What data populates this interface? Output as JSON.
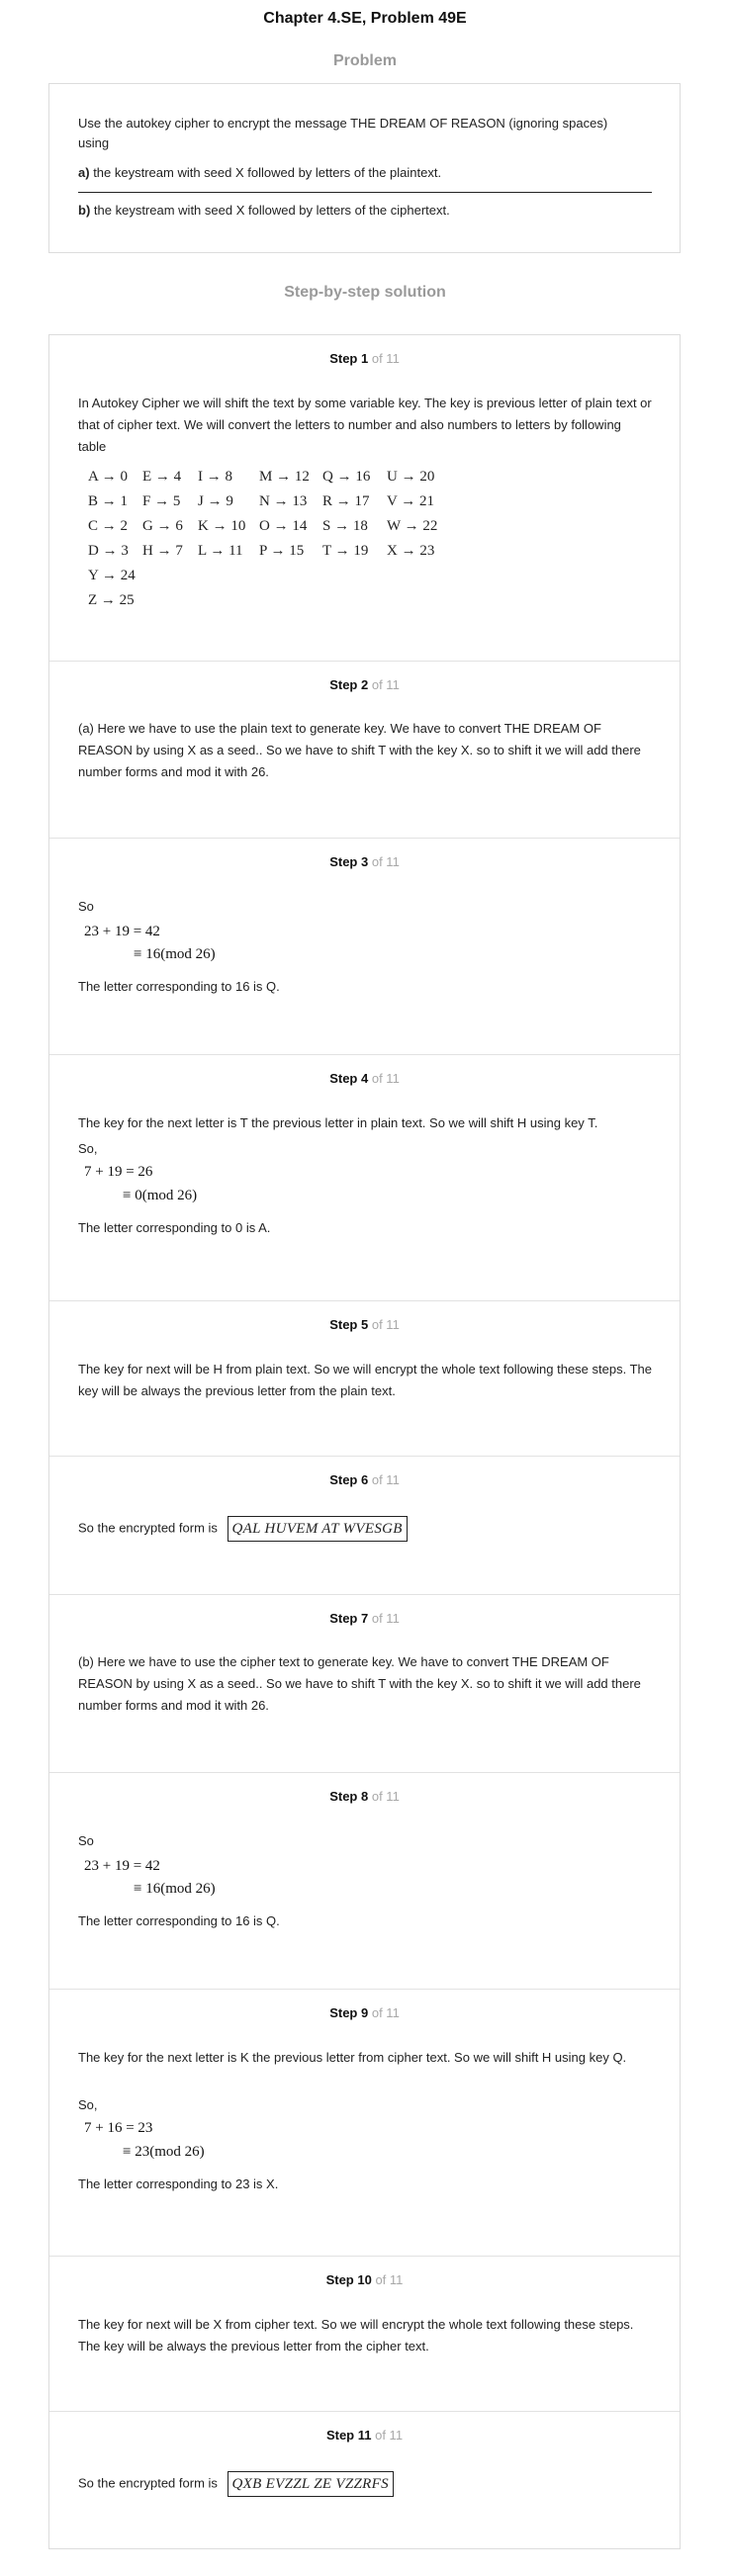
{
  "header": {
    "title": "Chapter 4.SE, Problem 49E"
  },
  "problem": {
    "heading": "Problem",
    "intro": "Use the autokey cipher to encrypt the message THE DREAM OF REASON (ignoring spaces) using",
    "part_a_label": "a)",
    "part_a_text": "the keystream with seed X followed by letters of the plaintext.",
    "part_b_label": "b)",
    "part_b_text": "the keystream with seed X followed by letters of the ciphertext."
  },
  "solution": {
    "heading": "Step-by-step solution",
    "of_label": "of 11",
    "steps": [
      {
        "label": "Step 1",
        "text": "In Autokey Cipher we will shift the text by some variable key. The key is previous letter of plain text or that of cipher text. We will convert the letters to number and also numbers to letters by following table",
        "table": [
          [
            "A → 0",
            "E → 4",
            "I → 8",
            "M → 12",
            "Q → 16",
            "U → 20"
          ],
          [
            "B → 1",
            "F → 5",
            "J → 9",
            "N → 13",
            "R → 17",
            "V → 21"
          ],
          [
            "C → 2",
            "G → 6",
            "K → 10",
            "O → 14",
            "S → 18",
            "W → 22"
          ],
          [
            "D → 3",
            "H → 7",
            "L → 11",
            "P → 15",
            "T → 19",
            "X → 23"
          ],
          [
            "Y → 24"
          ],
          [
            "Z → 25"
          ]
        ]
      },
      {
        "label": "Step 2",
        "text": "(a) Here we have to use the plain text to generate key. We have to convert THE DREAM OF REASON by using X as a seed.. So we have to shift T with the key X. so to shift it we will add there number forms and mod it with 26."
      },
      {
        "label": "Step 3",
        "so": "So",
        "eq1": "23 + 19 = 42",
        "eq2": "≡ 16(mod 26)",
        "result": "The letter corresponding to 16 is Q."
      },
      {
        "label": "Step 4",
        "text": "The key for the next letter is T the previous letter in plain text. So we will shift H using key T.",
        "so": "So,",
        "eq1": "7 + 19 = 26",
        "eq2": "≡ 0(mod 26)",
        "result": "The letter corresponding to 0 is A."
      },
      {
        "label": "Step 5",
        "text": "The key for next will be H from plain text. So we will encrypt the whole text following these steps. The key will be always the previous letter from the plain text."
      },
      {
        "label": "Step 6",
        "text": "So the encrypted form is",
        "answer": "QAL HUVEM AT WVESGB"
      },
      {
        "label": "Step 7",
        "text": "(b) Here we have to use the cipher text to generate key. We have to convert THE DREAM OF REASON by using X as a seed.. So we have to shift T with the key X. so to shift it we will add there number forms and mod it with 26."
      },
      {
        "label": "Step 8",
        "so": "So",
        "eq1": "23 + 19 = 42",
        "eq2": "≡ 16(mod 26)",
        "result": "The letter corresponding to 16 is Q."
      },
      {
        "label": "Step 9",
        "text": "The key for the next letter is K the previous letter from cipher text. So we will shift H using key Q.",
        "so": "So,",
        "eq1": "7 + 16 = 23",
        "eq2": "≡ 23(mod 26)",
        "result": "The letter corresponding to 23 is X."
      },
      {
        "label": "Step 10",
        "text": "The key for next will be X from cipher text. So we will encrypt the whole text following these steps. The key will be always the previous letter from the cipher text."
      },
      {
        "label": "Step 11",
        "text": "So the encrypted form is",
        "answer": "QXB EVZZL ZE VZZRFS"
      }
    ]
  }
}
